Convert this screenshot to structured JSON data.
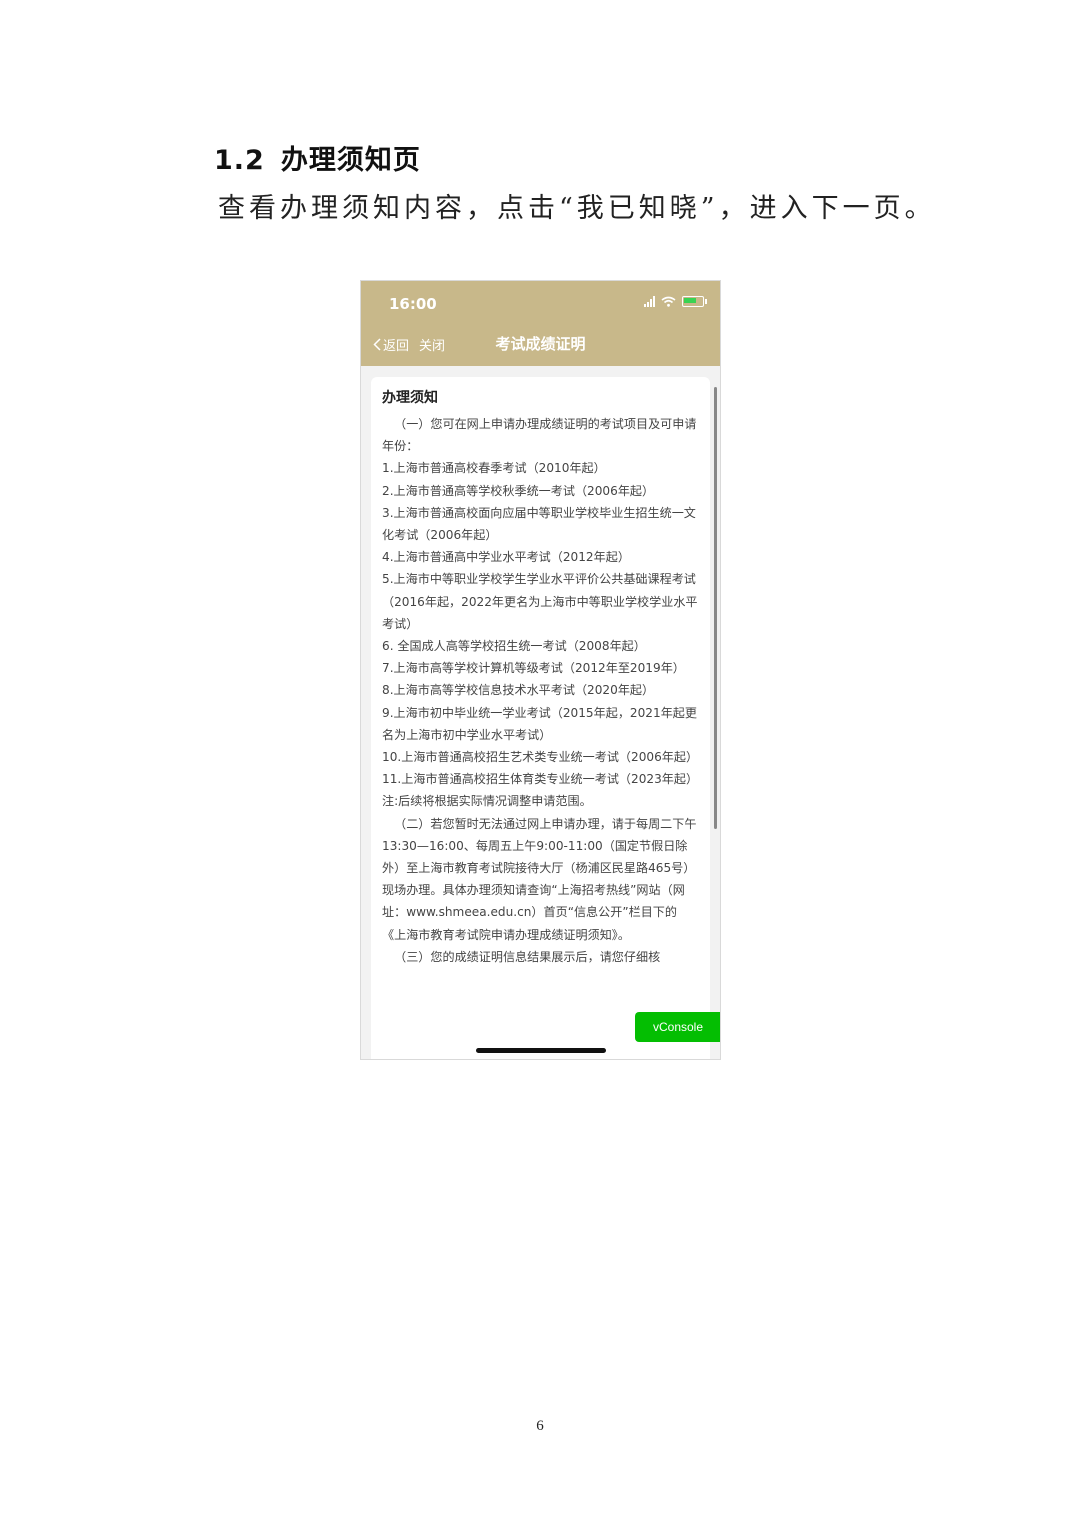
{
  "doc": {
    "section_number": "1.2",
    "section_title": "办理须知页",
    "instruction": "查看办理须知内容，点击“我已知晓”，进入下一页。",
    "page_number": "6"
  },
  "phone": {
    "status_time": "16:00",
    "nav": {
      "back_label": "返回",
      "close_label": "关闭",
      "title": "考试成绩证明"
    },
    "card_title": "办理须知",
    "notice_lines": [
      "（一）您可在网上申请办理成绩证明的考试项目及可申请年份：",
      "1.上海市普通高校春季考试（2010年起）",
      "2.上海市普通高等学校秋季统一考试（2006年起）",
      "3.上海市普通高校面向应届中等职业学校毕业生招生统一文化考试（2006年起）",
      "4.上海市普通高中学业水平考试（2012年起）",
      "5.上海市中等职业学校学生学业水平评价公共基础课程考试（2016年起，2022年更名为上海市中等职业学校学业水平考试）",
      "6. 全国成人高等学校招生统一考试（2008年起）",
      "7.上海市高等学校计算机等级考试（2012年至2019年）",
      "8.上海市高等学校信息技术水平考试（2020年起）",
      "9.上海市初中毕业统一学业考试（2015年起，2021年起更名为上海市初中学业水平考试）",
      "10.上海市普通高校招生艺术类专业统一考试（2006年起）",
      "11.上海市普通高校招生体育类专业统一考试（2023年起）",
      "注:后续将根据实际情况调整申请范围。",
      "（二）若您暂时无法通过网上申请办理，请于每周二下午13:30—16:00、每周五上午9:00-11:00（国定节假日除外）至上海市教育考试院接待大厅（杨浦区民星路465号）现场办理。具体办理须知请查询“上海招考热线”网站（网址：www.shmeea.edu.cn）首页“信息公开”栏目下的《上海市教育考试院申请办理成绩证明须知》。",
      "（三）您的成绩证明信息结果展示后，请您仔细核"
    ],
    "vconsole_label": "vConsole"
  }
}
